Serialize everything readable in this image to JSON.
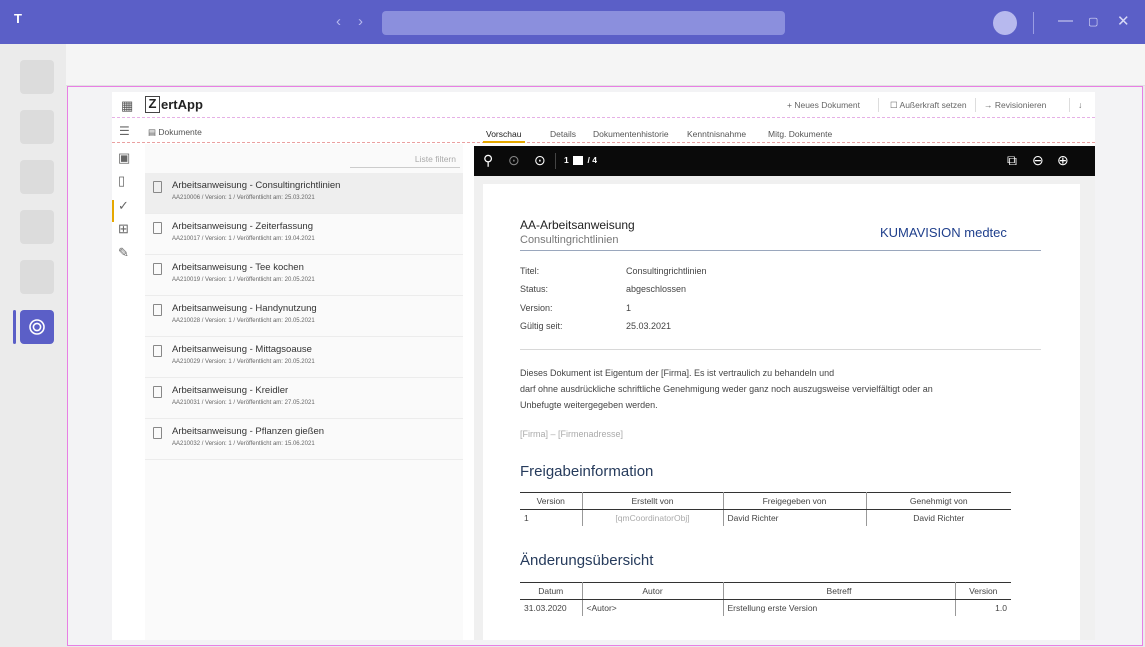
{
  "teams": {
    "logo_label": "T",
    "nav_back": "‹",
    "nav_forward": "›",
    "minimize": "—",
    "maximize": "▢",
    "close": "✕"
  },
  "app": {
    "name_letter": "Z",
    "name_rest": "ertApp",
    "commands": {
      "new_document": "+ Neues Dokument",
      "retire": "Außerkraft setzen",
      "revise": "→ Revisionieren",
      "download": "↓"
    },
    "documents_tab": "Dokumente",
    "view_tabs": [
      "Vorschau",
      "Details",
      "Dokumentenhistorie",
      "Kenntnisnahme",
      "Mitg. Dokumente"
    ]
  },
  "list": {
    "filter_placeholder": "Liste filtern",
    "items": [
      {
        "title": "Arbeitsanweisung - Consultingrichtlinien",
        "meta": "AA210006 / Version: 1 / Veröffentlicht am: 25.03.2021"
      },
      {
        "title": "Arbeitsanweisung - Zeiterfassung",
        "meta": "AA210017 / Version: 1 / Veröffentlicht am: 19.04.2021"
      },
      {
        "title": "Arbeitsanweisung - Tee kochen",
        "meta": "AA210019 / Version: 1 / Veröffentlicht am: 20.05.2021"
      },
      {
        "title": "Arbeitsanweisung - Handynutzung",
        "meta": "AA210028 / Version: 1 / Veröffentlicht am: 20.05.2021"
      },
      {
        "title": "Arbeitsanweisung - Mittagsoause",
        "meta": "AA210029 / Version: 1 / Veröffentlicht am: 20.05.2021"
      },
      {
        "title": "Arbeitsanweisung - Kreidler",
        "meta": "AA210031 / Version: 1 / Veröffentlicht am: 27.05.2021"
      },
      {
        "title": "Arbeitsanweisung - Pflanzen gießen",
        "meta": "AA210032 / Version: 1 / Veröffentlicht am: 15.06.2021"
      }
    ]
  },
  "viewer": {
    "current_page": "1",
    "page_total": "/ 4"
  },
  "document": {
    "title": "AA-Arbeitsanweisung",
    "subtitle": "Consultingrichtlinien",
    "brand": "KUMAVISION medtec",
    "meta": [
      {
        "label": "Titel:",
        "value": "Consultingrichtlinien"
      },
      {
        "label": "Status:",
        "value": "abgeschlossen"
      },
      {
        "label": "Version:",
        "value": "1"
      },
      {
        "label": "Gültig seit:",
        "value": "25.03.2021"
      }
    ],
    "para_line1": "Dieses Dokument ist Eigentum der [Firma]. Es ist vertraulich zu behandeln und",
    "para_line2": "darf ohne ausdrückliche schriftliche Genehmigung weder ganz noch auszugsweise vervielfältigt oder an",
    "para_line3": "Unbefugte weitergegeben werden.",
    "address": "[Firma] – [Firmenadresse]",
    "release_heading": "Freigabeinformation",
    "release_table": {
      "headers": [
        "Version",
        "Erstellt von",
        "Freigegeben von",
        "Genehmigt von"
      ],
      "row": [
        "1",
        "[qmCoordinatorObj]",
        "David Richter",
        "David Richter"
      ]
    },
    "changes_heading": "Änderungsübersicht",
    "changes_table": {
      "headers": [
        "Datum",
        "Autor",
        "Betreff",
        "Version"
      ],
      "row": [
        "31.03.2020",
        "<Autor>",
        "Erstellung erste Version",
        "1.0"
      ]
    }
  }
}
